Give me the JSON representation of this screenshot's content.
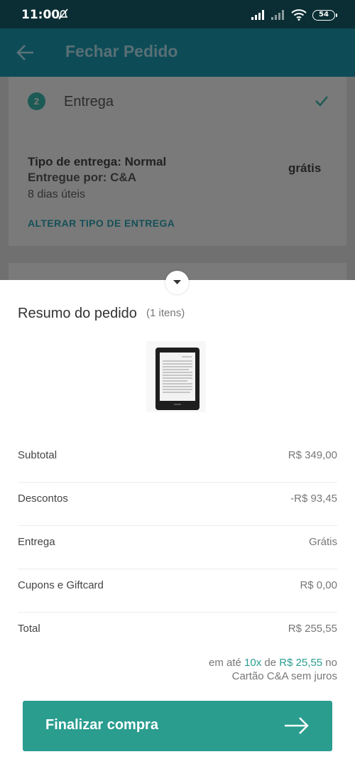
{
  "status_bar": {
    "time": "11:00",
    "battery": "54"
  },
  "app_bar": {
    "title": "Fechar Pedido"
  },
  "delivery_step": {
    "number": "2",
    "title": "Entrega",
    "delivery_type": "Tipo de entrega: Normal",
    "delivered_by": "Entregue por: C&A",
    "days": "8 dias úteis",
    "price": "grátis",
    "change_link": "ALTERAR TIPO DE ENTREGA"
  },
  "summary": {
    "title": "Resumo do pedido",
    "count": "(1 itens)",
    "rows": [
      {
        "label": "Subtotal",
        "value": "R$ 349,00"
      },
      {
        "label": "Descontos",
        "value": "-R$ 93,45"
      },
      {
        "label": "Entrega",
        "value": "Grátis"
      },
      {
        "label": "Cupons e Giftcard",
        "value": "R$ 0,00"
      },
      {
        "label": "Total",
        "value": "R$ 255,55"
      }
    ],
    "installments": {
      "prefix": "em até ",
      "times": "10x",
      "mid": " de ",
      "amount": "R$ 25,55",
      "suffix": " no",
      "line2": "Cartão C&A sem juros"
    }
  },
  "cta": {
    "label": "Finalizar compra"
  },
  "colors": {
    "accent": "#2a9d8f",
    "appbar": "#0d4c57",
    "status_bar": "#0a2e34"
  },
  "icons": [
    "silent-icon",
    "signal-icon",
    "wifi-icon",
    "battery-icon",
    "back-arrow-icon",
    "check-icon",
    "chevron-down-icon",
    "arrow-right-icon"
  ]
}
